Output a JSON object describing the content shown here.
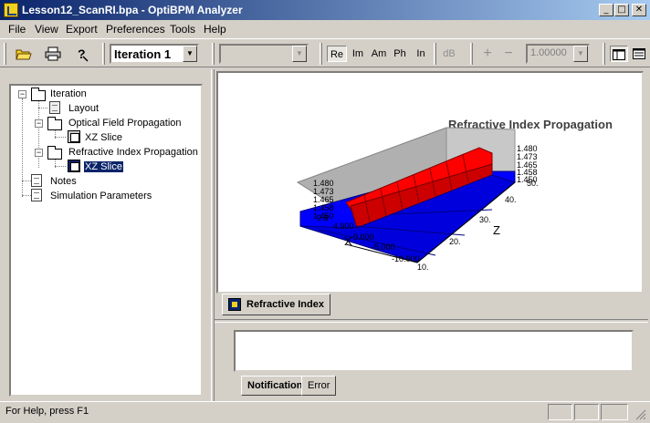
{
  "window": {
    "title": "Lesson12_ScanRI.bpa - OptiBPM Analyzer"
  },
  "menu": [
    "File",
    "View",
    "Export",
    "Preferences",
    "Tools",
    "Help"
  ],
  "toolbar": {
    "iteration_value": "Iteration 1",
    "second_combo_value": "",
    "modes": [
      "Re",
      "Im",
      "Am",
      "Ph",
      "In",
      "dB"
    ],
    "active_mode": "Re",
    "plus": "+",
    "minus": "−",
    "scale_value": "1.00000"
  },
  "tree": {
    "root": "Iteration",
    "layout": "Layout",
    "optical": "Optical Field Propagation",
    "optical_slice": "XZ Slice",
    "refractive": "Refractive Index Propagation",
    "refractive_slice": "XZ Slice",
    "notes": "Notes",
    "sim_params": "Simulation Parameters"
  },
  "chart_data": {
    "type": "surface3d",
    "title": "Refractive Index Propagation",
    "xlabel": "X",
    "zlabel": "Z",
    "z_ticks": [
      "10.",
      "20.",
      "30.",
      "40.",
      "50."
    ],
    "x_ticks": [
      "-10.000",
      "-5.000",
      "0.000",
      "4.900",
      "9.8"
    ],
    "value_ticks_left": [
      "1.480",
      "1.473",
      "1.465",
      "1.458",
      "1.450"
    ],
    "value_ticks_right": [
      "1.480",
      "1.473",
      "1.465",
      "1.458",
      "1.450"
    ],
    "value_range": [
      1.45,
      1.48
    ],
    "colors": {
      "high": "#ff0000",
      "low": "#0000ff"
    }
  },
  "view_tab": "Refractive Index",
  "notification_tabs": [
    "Notification",
    "Error"
  ],
  "status": {
    "text": "For Help, press F1"
  }
}
